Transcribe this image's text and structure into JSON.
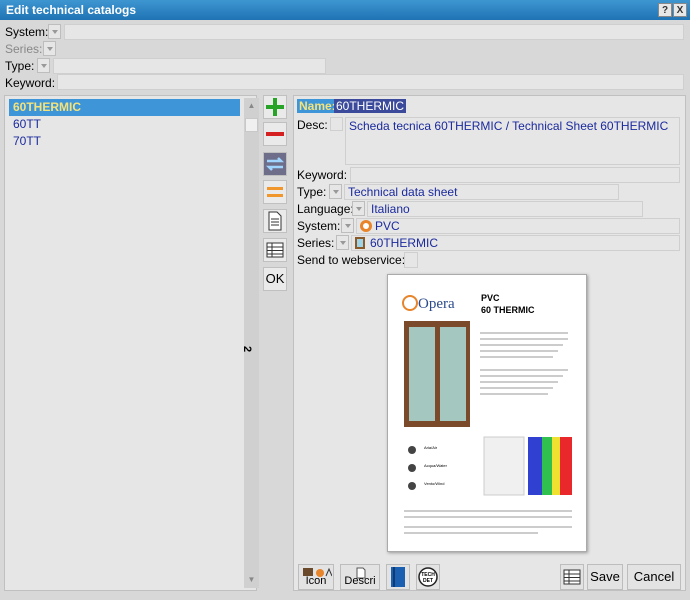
{
  "window": {
    "title": "Edit technical catalogs",
    "help_btn": "?",
    "close_btn": "X"
  },
  "filters": {
    "system_label": "System:",
    "series_label": "Series:",
    "type_label": "Type:",
    "keyword_label": "Keyword:"
  },
  "list": {
    "items": [
      {
        "label": "60THERMIC",
        "selected": true
      },
      {
        "label": "60TT",
        "selected": false
      },
      {
        "label": "70TT",
        "selected": false
      }
    ],
    "scroll_side_label": "2"
  },
  "toolbar": {
    "ok_label": "OK"
  },
  "form": {
    "name_label": "Name:",
    "name_value": "60THERMIC",
    "desc_label": "Desc:",
    "desc_value": "Scheda tecnica 60THERMIC / Technical Sheet 60THERMIC",
    "keyword_label": "Keyword:",
    "keyword_value": "",
    "type_label": "Type:",
    "type_value": "Technical data sheet",
    "language_label": "Language:",
    "language_value": "Italiano",
    "system_label": "System:",
    "system_value": "PVC",
    "series_label": "Series:",
    "series_value": "60THERMIC",
    "send_label": "Send to webservice:"
  },
  "preview": {
    "brand": "Opera",
    "heading1": "PVC",
    "heading2": "60 THERMIC",
    "aria": "Aria/Air",
    "acqua": "Acqua/Water",
    "vento": "Vento/Wind"
  },
  "bottom": {
    "icon_label": "Icon",
    "descri_label": "Descri",
    "save_label": "Save",
    "cancel_label": "Cancel"
  },
  "colors": {
    "title_bar": "#2a82c3",
    "selection": "#3e95d8",
    "link_text": "#1b2a9e"
  }
}
